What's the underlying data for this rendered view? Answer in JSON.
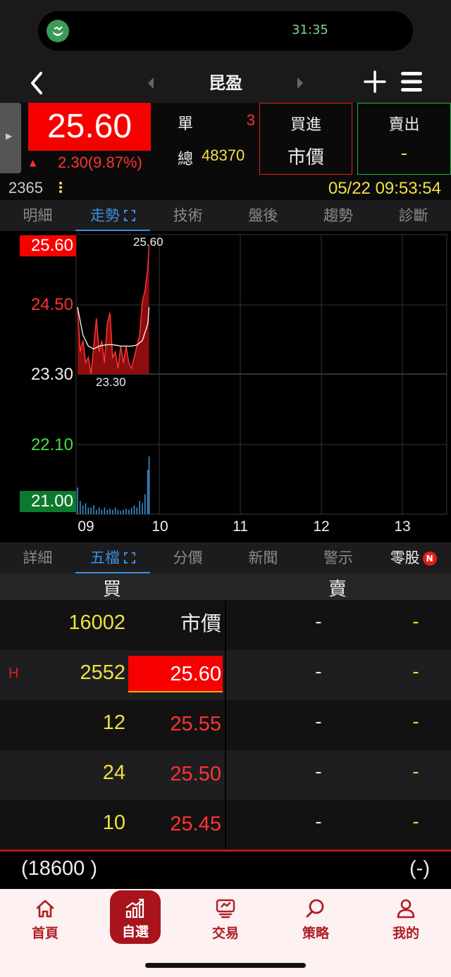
{
  "status": {
    "timer": "31:35",
    "app_icon": "app-status-icon"
  },
  "nav": {
    "title": "昆盈"
  },
  "quote": {
    "price": "25.60",
    "change": "2.30(9.87%)",
    "unit_label": "單",
    "unit_value": "3",
    "total_label": "總",
    "total_value": "48370",
    "buy_title": "買進",
    "buy_value": "市價",
    "sell_title": "賣出",
    "sell_value": "-",
    "code": "2365",
    "time": "05/22 09:53:54"
  },
  "top_tabs": [
    {
      "label": "明細"
    },
    {
      "label": "走勢"
    },
    {
      "label": "技術"
    },
    {
      "label": "盤後"
    },
    {
      "label": "趨勢"
    },
    {
      "label": "診斷"
    }
  ],
  "chart_data": {
    "type": "line",
    "y_ticks": [
      "25.60",
      "24.50",
      "23.30",
      "22.10",
      "21.00"
    ],
    "x_ticks": [
      "09",
      "10",
      "11",
      "12",
      "13"
    ],
    "high_label": "25.60",
    "low_label": "23.30",
    "ylim": [
      21.0,
      25.6
    ],
    "reference_price": 23.3,
    "colors": {
      "price_fill": "#8b0d0d",
      "price_line": "#ff3333",
      "avg_line": "#ffffff",
      "volume": "#3a8fd0"
    },
    "series": [
      {
        "x": [
          "09:00",
          "09:02",
          "09:04",
          "09:06",
          "09:08",
          "09:10",
          "09:12",
          "09:14",
          "09:16",
          "09:18",
          "09:20",
          "09:22",
          "09:24",
          "09:26",
          "09:28",
          "09:30",
          "09:32",
          "09:34",
          "09:36",
          "09:38",
          "09:40",
          "09:42",
          "09:44",
          "09:46",
          "09:48",
          "09:50",
          "09:52",
          "09:53"
        ],
        "values": [
          24.5,
          23.7,
          23.9,
          23.5,
          23.6,
          23.3,
          23.8,
          24.3,
          23.7,
          23.9,
          23.5,
          24.2,
          24.4,
          23.6,
          23.7,
          23.4,
          23.8,
          23.5,
          23.8,
          23.5,
          23.4,
          23.6,
          23.8,
          24.0,
          24.6,
          24.8,
          25.2,
          25.6
        ]
      },
      {
        "x": [
          "09:00",
          "09:04",
          "09:08",
          "09:12",
          "09:16",
          "09:20",
          "09:24",
          "09:28",
          "09:32",
          "09:36",
          "09:40",
          "09:44",
          "09:48",
          "09:52",
          "09:53"
        ],
        "values": [
          24.5,
          24.0,
          23.8,
          23.75,
          23.8,
          23.82,
          23.83,
          23.82,
          23.8,
          23.8,
          23.8,
          23.82,
          23.9,
          24.2,
          24.5
        ]
      }
    ],
    "volume": [
      120,
      60,
      40,
      50,
      30,
      30,
      40,
      20,
      30,
      20,
      30,
      20,
      25,
      20,
      30,
      20,
      15,
      20,
      25,
      20,
      30,
      40,
      30,
      60,
      50,
      90,
      200,
      260
    ]
  },
  "mid_tabs": [
    {
      "label": "詳細"
    },
    {
      "label": "五檔"
    },
    {
      "label": "分價"
    },
    {
      "label": "新聞"
    },
    {
      "label": "警示"
    },
    {
      "label": "零股"
    }
  ],
  "mid_badge": "N",
  "order_book": {
    "buy_header": "買",
    "sell_header": "賣",
    "rows": [
      {
        "marker": "",
        "bid_vol": "16002",
        "bid_price": "市價",
        "ask_price": "-",
        "ask_vol": "-"
      },
      {
        "marker": "H",
        "bid_vol": "2552",
        "bid_price": "25.60",
        "ask_price": "-",
        "ask_vol": "-"
      },
      {
        "marker": "",
        "bid_vol": "12",
        "bid_price": "25.55",
        "ask_price": "-",
        "ask_vol": "-"
      },
      {
        "marker": "",
        "bid_vol": "24",
        "bid_price": "25.50",
        "ask_price": "-",
        "ask_vol": "-"
      },
      {
        "marker": "",
        "bid_vol": "10",
        "bid_price": "25.45",
        "ask_price": "-",
        "ask_vol": "-"
      }
    ],
    "total_bid": "(18600 )",
    "total_ask": "(-)"
  },
  "bottom_nav": [
    {
      "label": "首頁",
      "icon": "home-icon"
    },
    {
      "label": "自選",
      "icon": "chart-bar-icon"
    },
    {
      "label": "交易",
      "icon": "trade-icon"
    },
    {
      "label": "策略",
      "icon": "search-icon"
    },
    {
      "label": "我的",
      "icon": "user-icon"
    }
  ]
}
